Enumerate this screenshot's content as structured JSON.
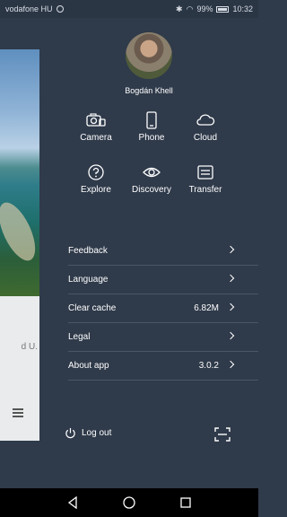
{
  "status_bar": {
    "carrier": "vodafone HU",
    "battery": "99%",
    "time": "10:32"
  },
  "background_panel": {
    "text": "d U."
  },
  "profile": {
    "name": "Bogdán Khell"
  },
  "grid": [
    {
      "label": "Camera",
      "icon": "camera-icon"
    },
    {
      "label": "Phone",
      "icon": "phone-icon"
    },
    {
      "label": "Cloud",
      "icon": "cloud-icon"
    },
    {
      "label": "Explore",
      "icon": "help-circle-icon"
    },
    {
      "label": "Discovery",
      "icon": "eye-icon"
    },
    {
      "label": "Transfer",
      "icon": "transfer-icon"
    }
  ],
  "menu": [
    {
      "label": "Feedback",
      "value": ""
    },
    {
      "label": "Language",
      "value": ""
    },
    {
      "label": "Clear cache",
      "value": "6.82M"
    },
    {
      "label": "Legal",
      "value": ""
    },
    {
      "label": "About app",
      "value": "3.0.2"
    }
  ],
  "footer": {
    "logout_label": "Log out"
  }
}
